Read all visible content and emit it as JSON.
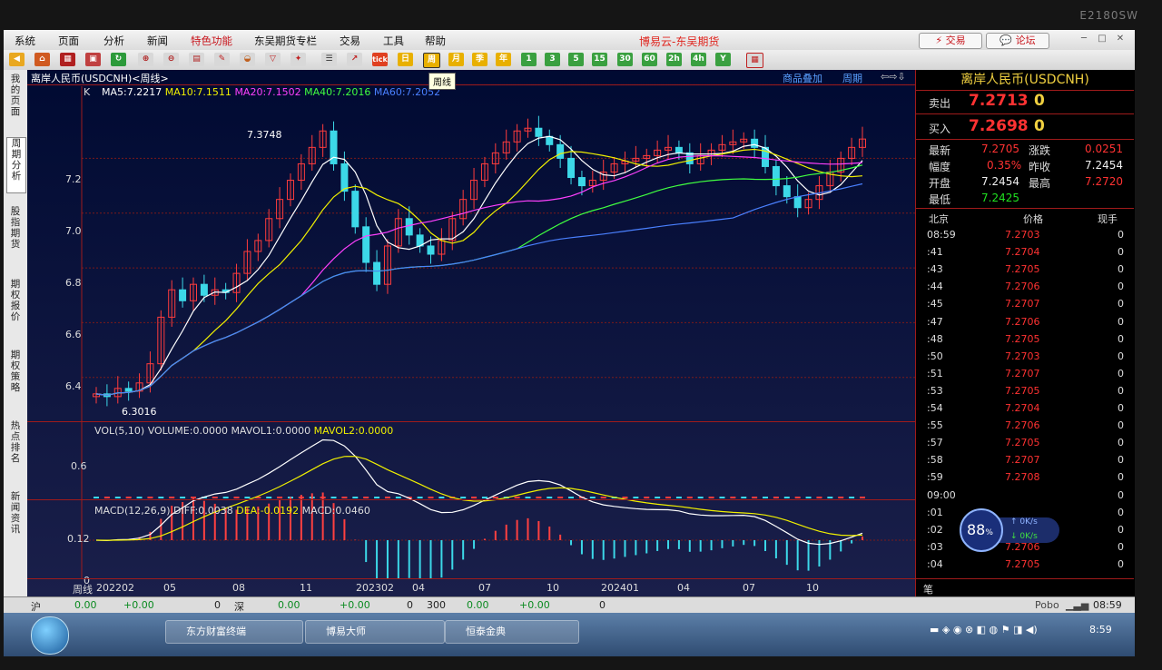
{
  "monitor": {
    "model": "E2180SW"
  },
  "menubar": {
    "items": [
      "系统",
      "页面",
      "分析",
      "新闻",
      "特色功能",
      "东吴期货专栏",
      "交易",
      "工具",
      "帮助"
    ],
    "app_title": "博易云-东吴期货",
    "trade_btn": "交易",
    "forum_btn": "论坛"
  },
  "toolbar": {
    "period_buttons": [
      "日",
      "周",
      "月",
      "季",
      "年",
      "1",
      "3",
      "5",
      "15",
      "30",
      "60",
      "2h",
      "4h",
      "Y"
    ],
    "tooltip": "周线"
  },
  "left_tabs": [
    "我的页面",
    "周期分析",
    "股指期货",
    "期权报价",
    "期权策略",
    "热点排名",
    "新闻资讯"
  ],
  "chart": {
    "title": "离岸人民币(USDCNH)<周线>",
    "overlay_link": "商品叠加",
    "period_link": "周期",
    "k_label": "K",
    "ma": [
      {
        "label": "MA5:7.2217",
        "color": "#ffffff"
      },
      {
        "label": "MA10:7.1511",
        "color": "#f0f000"
      },
      {
        "label": "MA20:7.1502",
        "color": "#ff40ff"
      },
      {
        "label": "MA40:7.2016",
        "color": "#40ff40"
      },
      {
        "label": "MA60:7.2052",
        "color": "#4a80ff"
      }
    ],
    "y_ticks": [
      "7.2",
      "7.0",
      "6.8",
      "6.6",
      "6.4"
    ],
    "high_label": "7.3748",
    "low_label": "6.3016",
    "vol_line": {
      "prefix": "VOL(5,10) VOLUME:0.0000 MAVOL1:0.0000 ",
      "mavol2": "MAVOL2:0.0000"
    },
    "vol_tick": "0.6",
    "macd_line": {
      "prefix": "MACD(12,26,9) DIFF:0.0038 ",
      "dea": "DEA:-0.0192",
      "macd": " MACD:0.0460"
    },
    "macd_ticks": [
      "0.12",
      "0"
    ],
    "x_axis_label": "周线",
    "x_ticks": [
      "202202",
      "05",
      "08",
      "11",
      "202302",
      "04",
      "07",
      "10",
      "202401",
      "04",
      "07",
      "10"
    ]
  },
  "chart_data": {
    "type": "candlestick",
    "title": "离岸人民币(USDCNH)<周线>",
    "y_ticks": [
      6.4,
      6.6,
      6.8,
      7.0,
      7.2
    ],
    "ylim": [
      6.25,
      7.45
    ],
    "max": 7.3748,
    "min": 6.3016,
    "last_close": 7.2705,
    "moving_averages": {
      "MA5": 7.2217,
      "MA10": 7.1511,
      "MA20": 7.1502,
      "MA40": 7.2016,
      "MA60": 7.2052
    },
    "macd": {
      "DIFF": 0.0038,
      "DEA": -0.0192,
      "MACD": 0.046
    },
    "x_ticks": [
      "202202",
      "05",
      "08",
      "11",
      "202302",
      "04",
      "07",
      "10",
      "202401",
      "04",
      "07",
      "10"
    ],
    "close_series": [
      6.34,
      6.33,
      6.36,
      6.35,
      6.38,
      6.45,
      6.62,
      6.72,
      6.68,
      6.74,
      6.7,
      6.72,
      6.71,
      6.78,
      6.86,
      6.9,
      6.98,
      7.05,
      7.12,
      7.18,
      7.24,
      7.3,
      7.18,
      7.08,
      6.95,
      6.82,
      6.74,
      6.88,
      6.98,
      6.92,
      6.88,
      6.85,
      6.9,
      6.98,
      7.05,
      7.12,
      7.18,
      7.22,
      7.26,
      7.3,
      7.31,
      7.28,
      7.25,
      7.2,
      7.13,
      7.1,
      7.12,
      7.15,
      7.18,
      7.19,
      7.2,
      7.21,
      7.23,
      7.24,
      7.22,
      7.18,
      7.21,
      7.23,
      7.25,
      7.26,
      7.27,
      7.24,
      7.17,
      7.1,
      7.06,
      7.02,
      7.05,
      7.1,
      7.15,
      7.2,
      7.24,
      7.2705
    ]
  },
  "quote": {
    "title": "离岸人民币(USDCNH)",
    "sell_label": "卖出",
    "sell_price": "7.2713",
    "sell_qty": "0",
    "buy_label": "买入",
    "buy_price": "7.2698",
    "buy_qty": "0",
    "latest_label": "最新",
    "latest": "7.2705",
    "change_label": "涨跌",
    "change": "0.0251",
    "pct_label": "幅度",
    "pct": "0.35%",
    "prev_label": "昨收",
    "prev": "7.2454",
    "open_label": "开盘",
    "open": "7.2454",
    "high_label": "最高",
    "high": "7.2720",
    "low_label": "最低",
    "low": "7.2425",
    "tick_header": {
      "time": "北京",
      "price": "价格",
      "qty": "现手"
    },
    "ticks": [
      {
        "time": "08:59",
        "price": "7.2703",
        "qty": "0"
      },
      {
        "time": ":41",
        "price": "7.2704",
        "qty": "0"
      },
      {
        "time": ":43",
        "price": "7.2705",
        "qty": "0"
      },
      {
        "time": ":44",
        "price": "7.2706",
        "qty": "0"
      },
      {
        "time": ":45",
        "price": "7.2707",
        "qty": "0"
      },
      {
        "time": ":47",
        "price": "7.2706",
        "qty": "0"
      },
      {
        "time": ":48",
        "price": "7.2705",
        "qty": "0"
      },
      {
        "time": ":50",
        "price": "7.2703",
        "qty": "0"
      },
      {
        "time": ":51",
        "price": "7.2707",
        "qty": "0"
      },
      {
        "time": ":53",
        "price": "7.2705",
        "qty": "0"
      },
      {
        "time": ":54",
        "price": "7.2704",
        "qty": "0"
      },
      {
        "time": ":55",
        "price": "7.2706",
        "qty": "0"
      },
      {
        "time": ":57",
        "price": "7.2705",
        "qty": "0"
      },
      {
        "time": ":58",
        "price": "7.2707",
        "qty": "0"
      },
      {
        "time": ":59",
        "price": "7.2708",
        "qty": "0"
      },
      {
        "time": "09:00",
        "price": "",
        "qty": "0"
      },
      {
        "time": ":01",
        "price": "",
        "qty": "0"
      },
      {
        "time": ":02",
        "price": "7.2709",
        "qty": "0"
      },
      {
        "time": ":03",
        "price": "7.2706",
        "qty": "0"
      },
      {
        "time": ":04",
        "price": "7.2705",
        "qty": "0"
      }
    ],
    "net_pct": "88",
    "net_up": "0K/s",
    "net_down": "0K/s",
    "bottom_tab": "笔"
  },
  "statusbar": {
    "sh_label": "沪",
    "sh_val": "0.00",
    "sh_chg": "+0.00",
    "sh_amt": "0",
    "sz_label": "深",
    "sz_val": "0.00",
    "sz_chg": "+0.00",
    "sz_amt": "0",
    "extra": "300",
    "extra_val": "0.00",
    "extra_chg": "+0.00",
    "extra_amt": "0",
    "brand": "Pobo",
    "time": "08:59"
  },
  "taskbar": {
    "tasks": [
      "东方财富终端",
      "博易大师",
      "恒泰金典"
    ],
    "clock": "8:59"
  }
}
